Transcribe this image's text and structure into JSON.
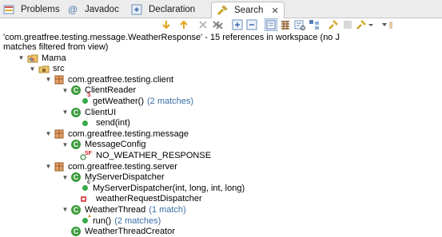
{
  "tabs": [
    {
      "label": "Problems",
      "icon": "problems-icon"
    },
    {
      "label": "Javadoc",
      "icon": "at-icon"
    },
    {
      "label": "Declaration",
      "icon": "declaration-icon"
    },
    {
      "label": "Search",
      "icon": "search-flashlight-icon",
      "active": true
    }
  ],
  "search_summary": {
    "line1": "'com.greatfree.testing.message.WeatherResponse' - 15 references in workspace (no J",
    "line2": "matches filtered from view)"
  },
  "tree": {
    "project": "Mama",
    "src": "src",
    "pkg_client": "com.greatfree.testing.client",
    "client_reader": "ClientReader",
    "get_weather": "getWeather()",
    "get_weather_matches": "(2 matches)",
    "client_ui": "ClientUI",
    "send": "send(int)",
    "pkg_message": "com.greatfree.testing.message",
    "message_config": "MessageConfig",
    "no_weather": "NO_WEATHER_RESPONSE",
    "pkg_server": "com.greatfree.testing.server",
    "my_server_dispatcher": "MyServerDispatcher",
    "my_server_ctor": "MyServerDispatcher(int, long, int, long)",
    "weather_request_dispatcher": "weatherRequestDispatcher",
    "weather_thread": "WeatherThread",
    "weather_thread_matches": "(1 match)",
    "run": "run()",
    "run_matches": "(2 matches)",
    "weather_thread_creator": "WeatherThreadCreator"
  },
  "colors": {
    "match_count": "#3a6ea5",
    "class_icon": "#3d9c3d",
    "method_icon": "#37a84c"
  }
}
